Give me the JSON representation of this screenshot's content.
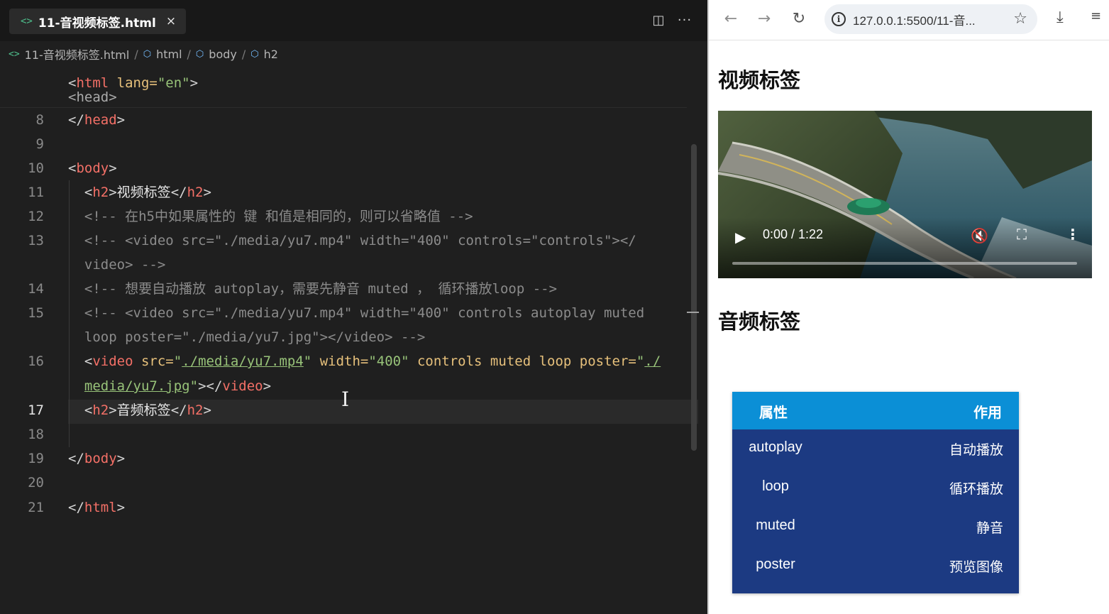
{
  "editor": {
    "tab": {
      "icon": "html-file-icon",
      "label": "11-音视频标签.html",
      "close": "×"
    },
    "toolbar": {
      "split_icon": "◫",
      "more_icon": "···"
    },
    "breadcrumb": {
      "file": "11-音视频标签.html",
      "items": [
        "html",
        "body",
        "h2"
      ],
      "sep": "/"
    },
    "sticky_line": {
      "open": "<",
      "tag": "html",
      "attr": " lang=",
      "val": "\"en\"",
      "close": ">",
      "below": "<head>"
    },
    "line_numbers": [
      "8",
      "9",
      "10",
      "11",
      "12",
      "",
      "13",
      "",
      "14",
      "15",
      "",
      "16",
      "",
      "17",
      "18",
      "19",
      "20",
      "21"
    ],
    "lines": {
      "l8": {
        "a": "</",
        "t": "head",
        "c": ">"
      },
      "l10": {
        "a": "<",
        "t": "body",
        "c": ">"
      },
      "l11": {
        "a": "  <",
        "t": "h2",
        "c": ">",
        "txt": "视频标签",
        "a2": "</",
        "t2": "h2",
        "c2": ">"
      },
      "l12": "  <!-- 在h5中如果属性的 键 和值是相同的，则可以省略值 -->",
      "l13a": "  <!-- <video src=\"./media/yu7.mp4\" width=\"400\" controls=\"controls\"></",
      "l13b": "  video> -->",
      "l14": "  <!-- 想要自动播放 autoplay，需要先静音 muted ， 循环播放loop -->",
      "l15a": "  <!-- <video src=\"./media/yu7.mp4\" width=\"400\" controls autoplay muted",
      "l15b": "  loop poster=\"./media/yu7.jpg\"></video> -->",
      "l16a": {
        "a": "  <",
        "t": "video",
        "sp": " ",
        "at1": "src=",
        "q1": "\"",
        "v1": "./media/yu7.mp4",
        "q1e": "\"",
        "sp2": " ",
        "at2": "width=",
        "v2": "\"400\"",
        "at3": " controls muted loop poster=",
        "q3": "\"",
        "v3": "./"
      },
      "l16b": {
        "pre": "  ",
        "v": "media/yu7.jpg",
        "q": "\"",
        "a": "></",
        "t": "video",
        "c": ">"
      },
      "l17": {
        "a": "  <",
        "t": "h2",
        "c": ">",
        "txt": "音频标签",
        "a2": "</",
        "t2": "h2",
        "c2": ">"
      },
      "l19": {
        "a": "</",
        "t": "body",
        "c": ">"
      },
      "l21": {
        "a": "</",
        "t": "html",
        "c": ">"
      }
    }
  },
  "browser": {
    "nav": {
      "back_icon": "←",
      "forward_icon": "→",
      "reload_icon": "↻"
    },
    "url": "127.0.0.1:5500/11-音...",
    "info_icon": "i",
    "star_icon": "☆",
    "download_icon": "⤓",
    "menu_icon": "≡",
    "page": {
      "h2_video": "视频标签",
      "h2_audio": "音频标签",
      "video": {
        "time": "0:00 / 1:22",
        "play_icon": "▶",
        "mute_icon": "🔇",
        "fullscreen_icon": "⛶",
        "more_icon": "⋮"
      }
    }
  },
  "attr_table": {
    "headers": [
      "属性",
      "作用"
    ],
    "rows": [
      [
        "autoplay",
        "自动播放"
      ],
      [
        "loop",
        "循环播放"
      ],
      [
        "muted",
        "静音"
      ],
      [
        "poster",
        "预览图像"
      ]
    ]
  },
  "colors": {
    "tag": "#f47067",
    "attr": "#e6c07b",
    "string": "#98c379",
    "comment": "#8b8b8b",
    "table_bg": "#1c3a82",
    "table_head": "#0b8fd6"
  }
}
